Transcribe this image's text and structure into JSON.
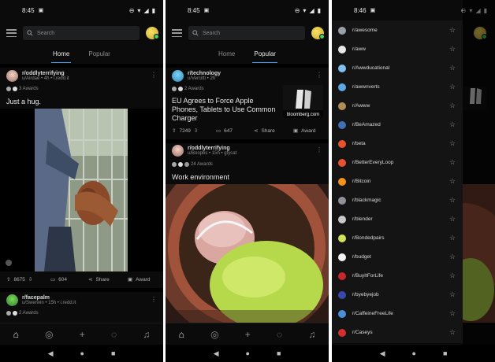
{
  "panels": [
    {
      "status": {
        "time": "8:45"
      },
      "search_placeholder": "Search",
      "tabs": [
        "Home",
        "Popular"
      ],
      "active_tab": 0,
      "posts": [
        {
          "subreddit": "r/oddlyterrifying",
          "meta": "u/Airdae • 4h • i.redd.it",
          "awards": "3 Awards",
          "title": "Just a hug.",
          "upvotes": "8675",
          "comments": "604",
          "share": "Share",
          "award_btn": "Award"
        },
        {
          "subreddit": "r/facepalm",
          "meta": "u/Swerwin • 15h • i.redd.it",
          "awards": "2 Awards"
        }
      ]
    },
    {
      "status": {
        "time": "8:45"
      },
      "search_placeholder": "Search",
      "tabs": [
        "Home",
        "Popular"
      ],
      "active_tab": 1,
      "posts": [
        {
          "subreddit": "r/technology",
          "meta": "u/Vercitti • 2h",
          "awards": "2 Awards",
          "title": "EU Agrees to Force Apple Phones, Tablets to Use Common Charger",
          "link_source": "bloomberg.com",
          "upvotes": "7249",
          "comments": "647",
          "share": "Share",
          "award_btn": "Award"
        },
        {
          "subreddit": "r/oddlyterrifying",
          "meta": "u/Boopbs • 15h • gfycat",
          "awards": "24 Awards",
          "title": "Work environment"
        }
      ]
    },
    {
      "status": {
        "time": "8:46"
      },
      "drawer_items": [
        {
          "label": "r/awesome",
          "color": "#9aa0a6"
        },
        {
          "label": "r/aww",
          "color": "#e8e8e8"
        },
        {
          "label": "r/Awwducational",
          "color": "#7ec0ee"
        },
        {
          "label": "r/awwnverts",
          "color": "#5aa9e6"
        },
        {
          "label": "r/Awww",
          "color": "#b08d57"
        },
        {
          "label": "r/BeAmazed",
          "color": "#3f6fb5"
        },
        {
          "label": "r/beta",
          "color": "#e8532e"
        },
        {
          "label": "r/BetterEveryLoop",
          "color": "#e8532e"
        },
        {
          "label": "r/Bitcoin",
          "color": "#f7931a"
        },
        {
          "label": "r/blackmagic",
          "color": "#8f9298"
        },
        {
          "label": "r/blender",
          "color": "#c8c8c8"
        },
        {
          "label": "r/Bondedpairs",
          "color": "#d4e157"
        },
        {
          "label": "r/budget",
          "color": "#f5f5f5"
        },
        {
          "label": "r/BuyItForLife",
          "color": "#c62828"
        },
        {
          "label": "r/byebyejob",
          "color": "#3949ab"
        },
        {
          "label": "r/CaffeineFreeLife",
          "color": "#4a90d9"
        },
        {
          "label": "r/Caseys",
          "color": "#d32f2f"
        }
      ]
    }
  ],
  "colors": {
    "background": "#0b0b0b",
    "accent": "#3d9df3",
    "drawer": "#141414"
  }
}
